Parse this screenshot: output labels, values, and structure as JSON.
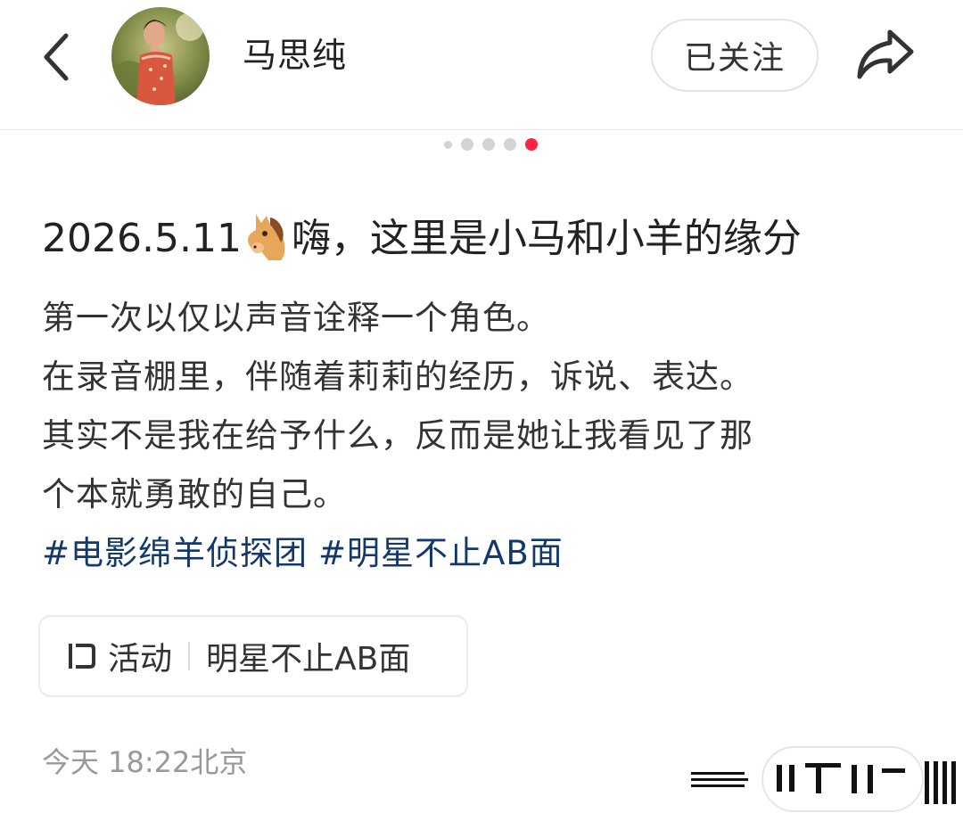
{
  "header": {
    "back_icon": "chevron-left-icon",
    "username": "马思纯",
    "follow_label": "已关注",
    "share_icon": "share-arrow-icon"
  },
  "pager": {
    "total": 5,
    "active_index": 4,
    "accent": "#ff2442"
  },
  "post": {
    "title_date": "2026.5.11",
    "title_emoji": "horse-face-emoji",
    "title_text": "嗨，这里是小马和小羊的缘分",
    "lines": [
      "第一次以仅以声音诠释一个角色。",
      "在录音棚里，伴随着莉莉的经历，诉说、表达。",
      "其实不是我在给予什么，反而是她让我看见了那",
      "个本就勇敢的自己。"
    ],
    "tags": [
      "#电影绵羊侦探团",
      "#明星不止AB面"
    ],
    "tag_color": "#13386c"
  },
  "activity": {
    "icon": "activity-flag-icon",
    "label": "活动",
    "name": "明星不止AB面"
  },
  "footer": {
    "date": "今天 18:22北京"
  }
}
